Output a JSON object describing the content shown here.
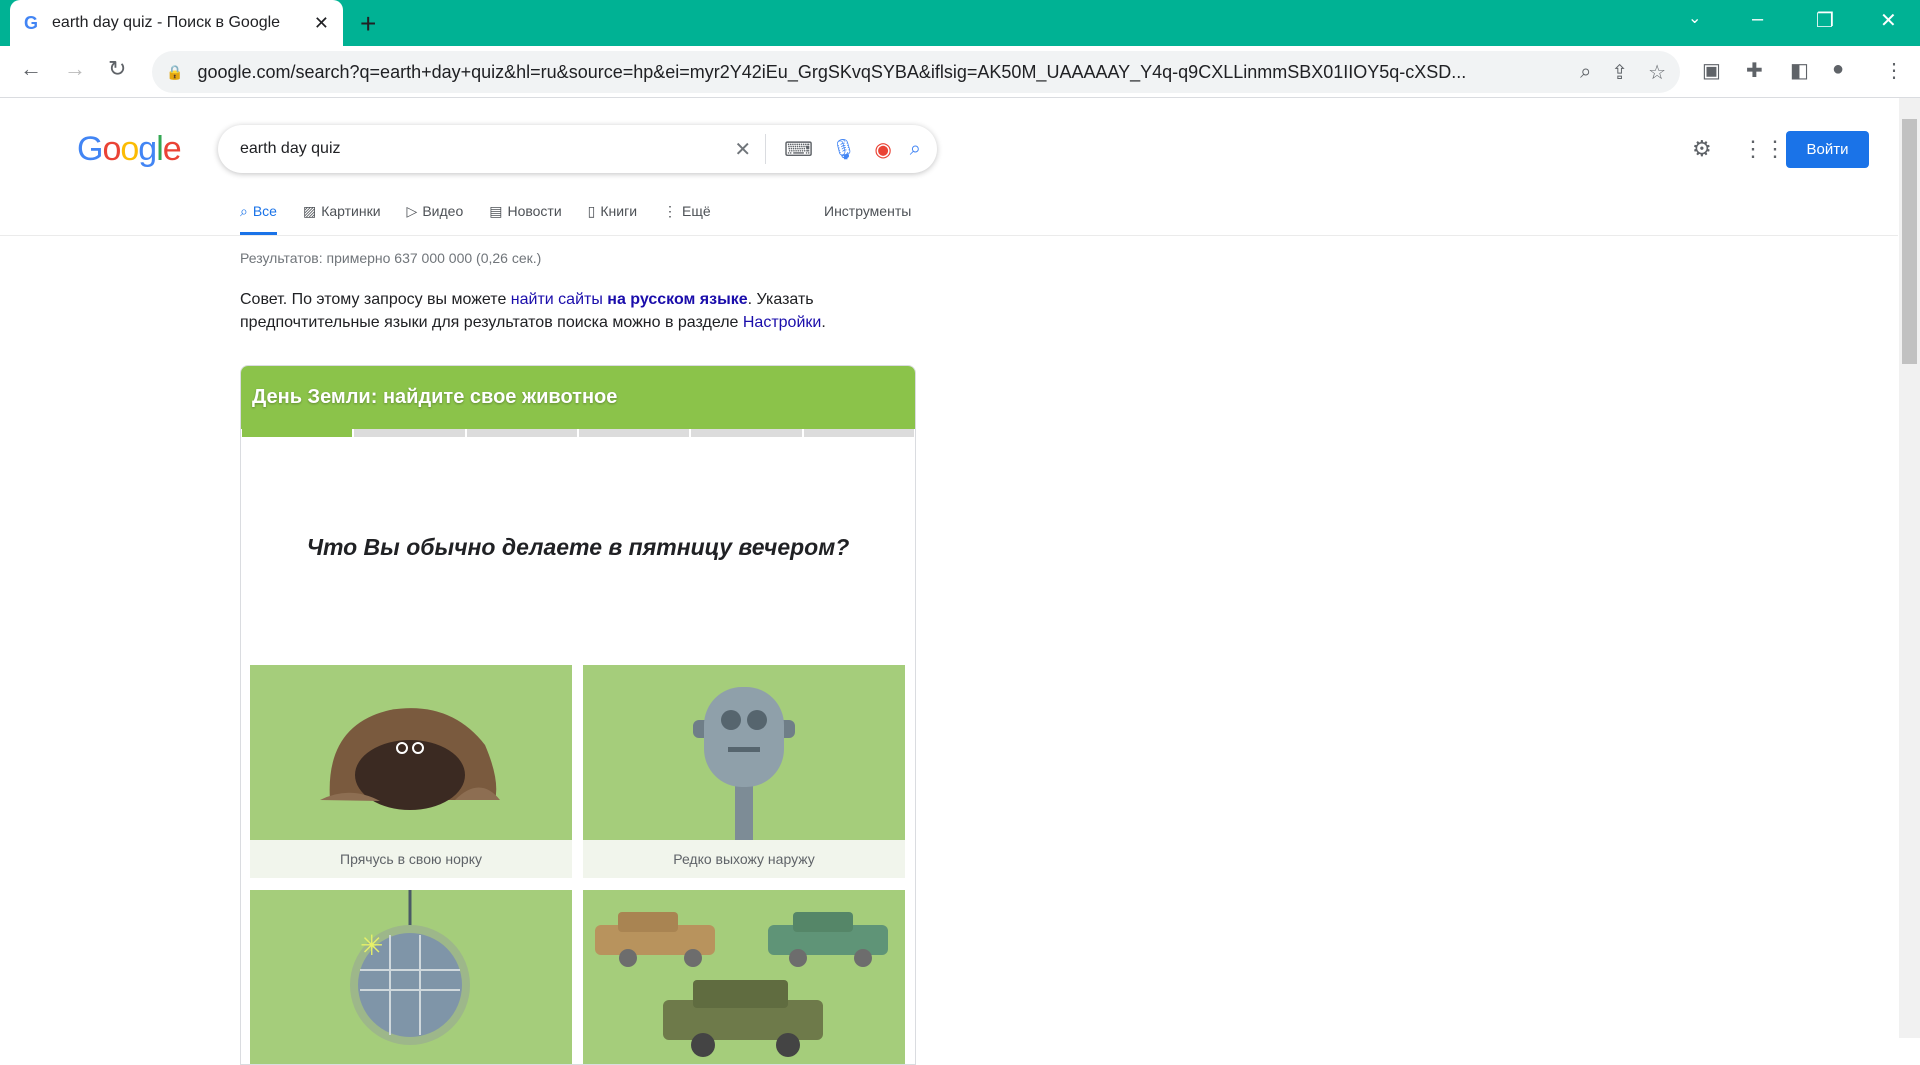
{
  "browser": {
    "tab_title": "earth day quiz - Поиск в Google",
    "url": "google.com/search?q=earth+day+quiz&hl=ru&source=hp&ei=myr2Y42iEu_GrgSKvqSYBA&iflsig=AK50M_UAAAAAY_Y4q-q9CXLLinmmSBX01IIOY5q-cXSD..."
  },
  "header": {
    "logo": "Google",
    "query": "earth day quiz",
    "signin_label": "Войти"
  },
  "tabs": [
    {
      "label": "Все",
      "icon": "search-icon"
    },
    {
      "label": "Картинки",
      "icon": "image-icon"
    },
    {
      "label": "Видео",
      "icon": "play-icon"
    },
    {
      "label": "Новости",
      "icon": "news-icon"
    },
    {
      "label": "Книги",
      "icon": "book-icon"
    },
    {
      "label": "Ещё",
      "icon": "more-vert-icon"
    }
  ],
  "tools_label": "Инструменты",
  "stats": "Результатов: примерно 637 000 000 (0,26 сек.)",
  "tip": {
    "prefix": "Совет. По этому запросу вы можете ",
    "link1": "найти сайты",
    "link2": "на русском языке",
    "middle": ". Указать предпочтительные языки для результатов поиска можно в разделе ",
    "link3": "Настройки",
    "suffix": "."
  },
  "quiz": {
    "title": "День Земли: найдите свое животное",
    "progress_step": 1,
    "progress_total": 6,
    "question": "Что Вы обычно делаете в пятницу вечером?",
    "options": [
      {
        "label": "Прячусь в свою норку"
      },
      {
        "label": "Редко выхожу наружу"
      },
      {
        "label": ""
      },
      {
        "label": ""
      }
    ],
    "accent": "#8bc34a"
  }
}
